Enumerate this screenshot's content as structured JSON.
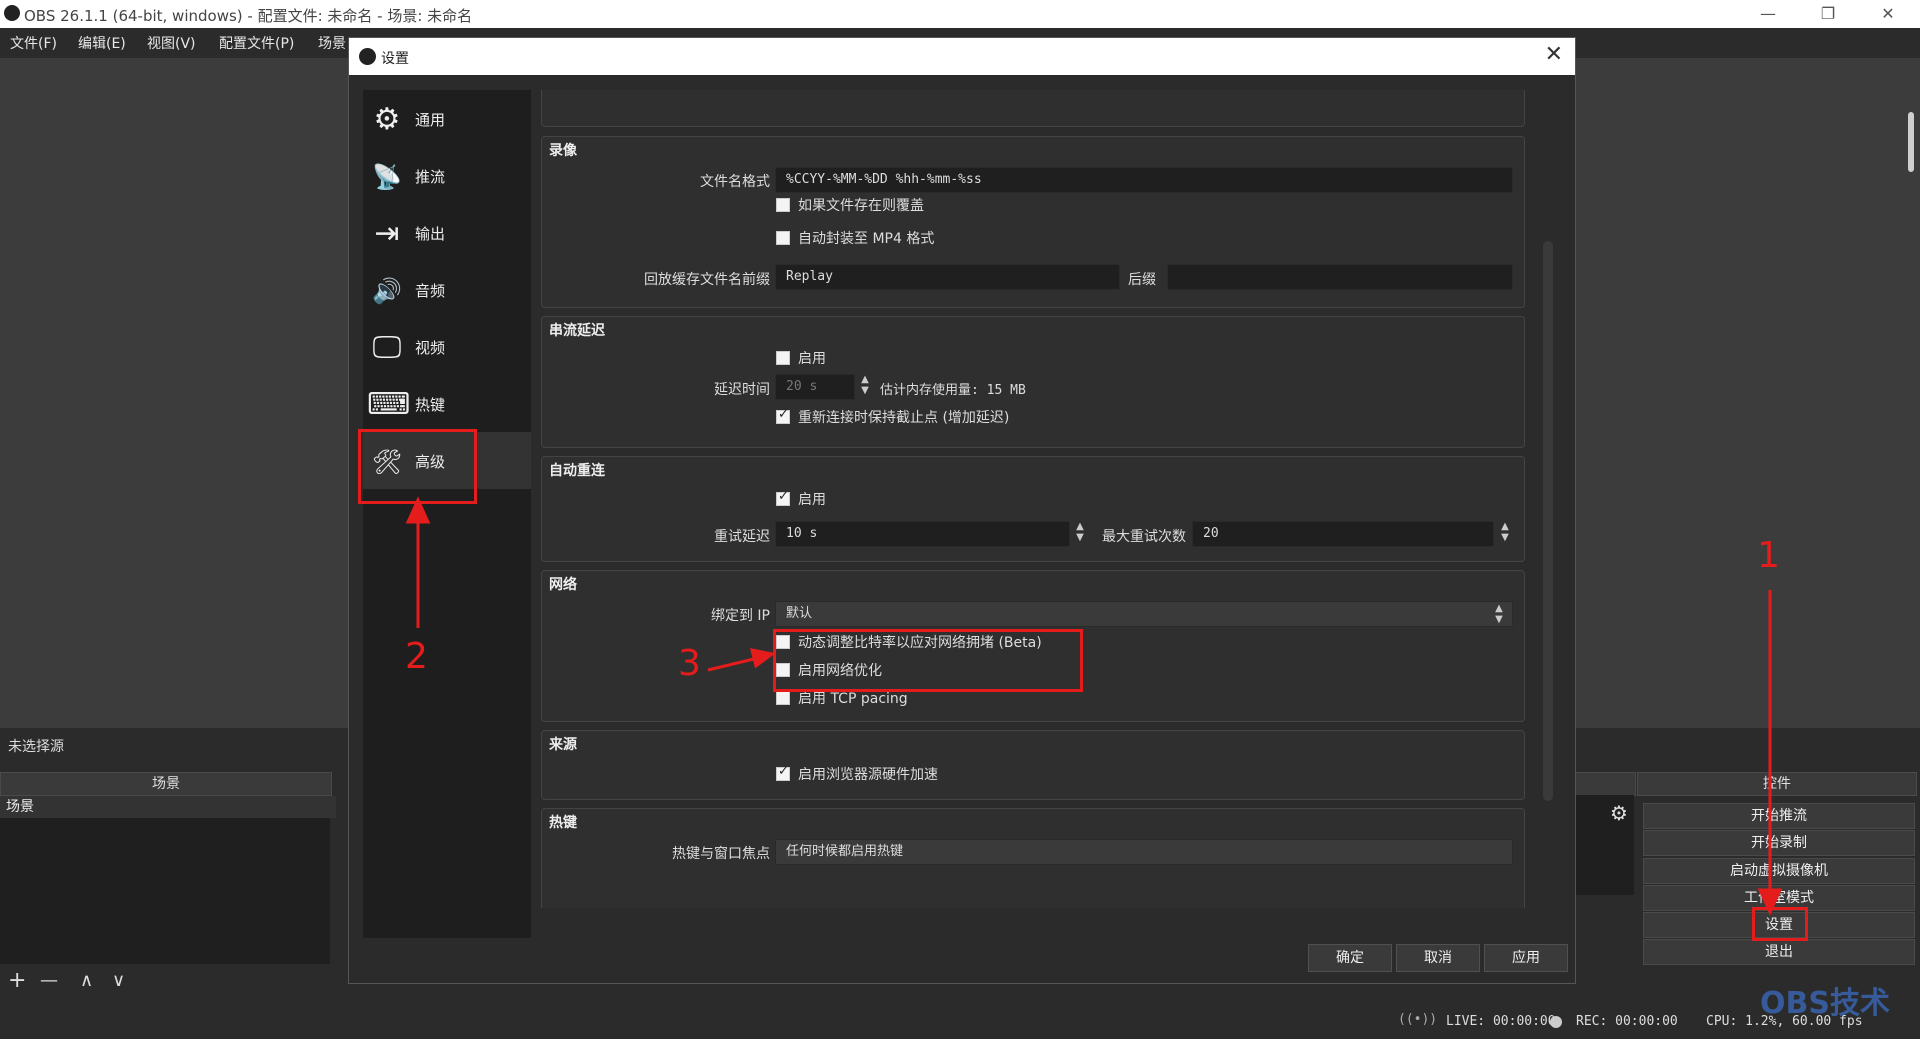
{
  "window": {
    "title": "OBS 26.1.1 (64-bit, windows) - 配置文件: 未命名 - 场景: 未命名",
    "minimize": "—",
    "restore": "❐",
    "close": "✕"
  },
  "menu": [
    "文件(F)",
    "编辑(E)",
    "视图(V)",
    "配置文件(P)",
    "场景"
  ],
  "docks": {
    "no_source": "未选择源",
    "scenes_header": "场景",
    "scene_item": "场景",
    "controls_header": "控件",
    "controls": [
      "开始推流",
      "开始录制",
      "启动虚拟摄像机",
      "工作室模式",
      "设置",
      "退出"
    ],
    "scene_toolbar": [
      "+",
      "—",
      "∧",
      "∨"
    ]
  },
  "status": {
    "live": "LIVE: 00:00:00",
    "rec": "REC: 00:00:00",
    "cpu": "CPU: 1.2%, 60.00 fps"
  },
  "watermark": "OBS技术",
  "dialog": {
    "title": "设置",
    "close": "✕",
    "sidebar": [
      {
        "label": "通用",
        "icon": "gear-icon",
        "glyph": "⚙"
      },
      {
        "label": "推流",
        "icon": "broadcast-icon",
        "glyph": "📡"
      },
      {
        "label": "输出",
        "icon": "output-icon",
        "glyph": "⇥"
      },
      {
        "label": "音频",
        "icon": "speaker-icon",
        "glyph": "🔊"
      },
      {
        "label": "视频",
        "icon": "monitor-icon",
        "glyph": "🖵"
      },
      {
        "label": "热键",
        "icon": "keyboard-icon",
        "glyph": "⌨"
      },
      {
        "label": "高级",
        "icon": "tools-icon",
        "glyph": "🛠"
      }
    ],
    "recording": {
      "title": "录像",
      "filename_label": "文件名格式",
      "filename_value": "%CCYY-%MM-%DD %hh-%mm-%ss",
      "overwrite_label": "如果文件存在则覆盖",
      "automux_label": "自动封装至 MP4 格式",
      "replay_prefix_label": "回放缓存文件名前缀",
      "replay_prefix_value": "Replay",
      "suffix_label": "后缀",
      "suffix_value": ""
    },
    "stream_delay": {
      "title": "串流延迟",
      "enable_label": "启用",
      "duration_label": "延迟时间",
      "duration_value": "20 s",
      "memory_label": "估计内存使用量: 15 MB",
      "preserve_label": "重新连接时保持截止点 (增加延迟)"
    },
    "reconnect": {
      "title": "自动重连",
      "enable_label": "启用",
      "retry_delay_label": "重试延迟",
      "retry_delay_value": "10 s",
      "max_retries_label": "最大重试次数",
      "max_retries_value": "20"
    },
    "network": {
      "title": "网络",
      "bind_ip_label": "绑定到 IP",
      "bind_ip_value": "默认",
      "dynamic_bitrate_label": "动态调整比特率以应对网络拥堵 (Beta)",
      "network_opt_label": "启用网络优化",
      "tcp_pacing_label": "启用 TCP pacing"
    },
    "sources": {
      "title": "来源",
      "browser_hw_label": "启用浏览器源硬件加速"
    },
    "hotkeys": {
      "title": "热键",
      "focus_label": "热键与窗口焦点",
      "focus_value": "任何时候都启用热键"
    },
    "buttons": {
      "ok": "确定",
      "cancel": "取消",
      "apply": "应用"
    }
  },
  "annotations": {
    "one": "1",
    "two": "2",
    "three": "3"
  },
  "colors": {
    "accent_red": "#e51c1c",
    "bg": "#2b2b2b"
  }
}
